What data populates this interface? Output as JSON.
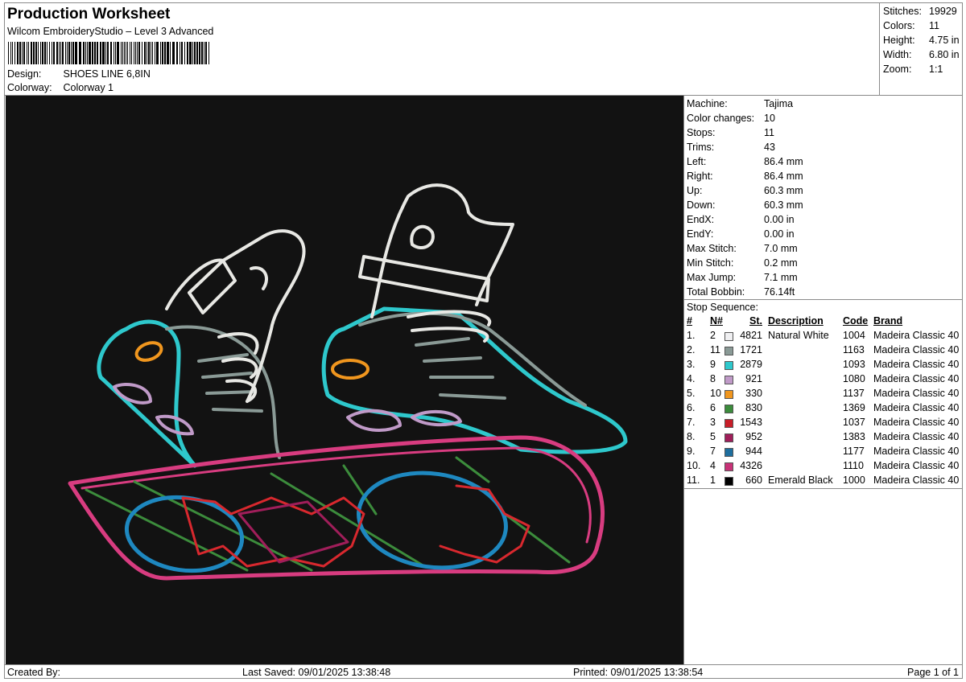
{
  "header": {
    "title": "Production Worksheet",
    "software": "Wilcom EmbroideryStudio – Level 3 Advanced",
    "design_label": "Design:",
    "design_value": "SHOES LINE 6,8IN",
    "colorway_label": "Colorway:",
    "colorway_value": "Colorway 1"
  },
  "summary": [
    {
      "label": "Stitches:",
      "value": "19929"
    },
    {
      "label": "Colors:",
      "value": "11"
    },
    {
      "label": "Height:",
      "value": "4.75 in"
    },
    {
      "label": "Width:",
      "value": "6.80 in"
    },
    {
      "label": "Zoom:",
      "value": "1:1"
    }
  ],
  "machine": [
    {
      "label": "Machine:",
      "value": "Tajima"
    },
    {
      "label": "Color changes:",
      "value": "10"
    },
    {
      "label": "Stops:",
      "value": "11"
    },
    {
      "label": "Trims:",
      "value": "43"
    },
    {
      "label": "Left:",
      "value": "86.4 mm"
    },
    {
      "label": "Right:",
      "value": "86.4 mm"
    },
    {
      "label": "Up:",
      "value": "60.3 mm"
    },
    {
      "label": "Down:",
      "value": "60.3 mm"
    },
    {
      "label": "EndX:",
      "value": "0.00 in"
    },
    {
      "label": "EndY:",
      "value": "0.00 in"
    },
    {
      "label": "Max Stitch:",
      "value": "7.0 mm"
    },
    {
      "label": "Min Stitch:",
      "value": "0.2 mm"
    },
    {
      "label": "Max Jump:",
      "value": "7.1 mm"
    },
    {
      "label": "Total Bobbin:",
      "value": "76.14ft"
    }
  ],
  "stop_sequence": {
    "label": "Stop Sequence:",
    "headers": {
      "num": "#",
      "n": "N#",
      "st": "St.",
      "desc": "Description",
      "code": "Code",
      "brand": "Brand"
    },
    "rows": [
      {
        "num": "1.",
        "n": "2",
        "color": "#f0f0f2",
        "st": "4821",
        "desc": "Natural White",
        "code": "1004",
        "brand": "Madeira Classic 40"
      },
      {
        "num": "2.",
        "n": "11",
        "color": "#8a9a96",
        "st": "1721",
        "desc": "",
        "code": "1163",
        "brand": "Madeira Classic 40"
      },
      {
        "num": "3.",
        "n": "9",
        "color": "#2ec8cc",
        "st": "2879",
        "desc": "",
        "code": "1093",
        "brand": "Madeira Classic 40"
      },
      {
        "num": "4.",
        "n": "8",
        "color": "#c09ac8",
        "st": "921",
        "desc": "",
        "code": "1080",
        "brand": "Madeira Classic 40"
      },
      {
        "num": "5.",
        "n": "10",
        "color": "#f0961e",
        "st": "330",
        "desc": "",
        "code": "1137",
        "brand": "Madeira Classic 40"
      },
      {
        "num": "6.",
        "n": "6",
        "color": "#3c8c3c",
        "st": "830",
        "desc": "",
        "code": "1369",
        "brand": "Madeira Classic 40"
      },
      {
        "num": "7.",
        "n": "3",
        "color": "#c81e28",
        "st": "1543",
        "desc": "",
        "code": "1037",
        "brand": "Madeira Classic 40"
      },
      {
        "num": "8.",
        "n": "5",
        "color": "#a01e5a",
        "st": "952",
        "desc": "",
        "code": "1383",
        "brand": "Madeira Classic 40"
      },
      {
        "num": "9.",
        "n": "7",
        "color": "#1e6e9e",
        "st": "944",
        "desc": "",
        "code": "1177",
        "brand": "Madeira Classic 40"
      },
      {
        "num": "10.",
        "n": "4",
        "color": "#c83278",
        "st": "4326",
        "desc": "",
        "code": "1110",
        "brand": "Madeira Classic 40"
      },
      {
        "num": "11.",
        "n": "1",
        "color": "#000000",
        "st": "660",
        "desc": "Emerald Black",
        "code": "1000",
        "brand": "Madeira Classic 40"
      }
    ]
  },
  "footer": {
    "created_by": "Created By:",
    "last_saved": "Last Saved: 09/01/2025 13:38:48",
    "printed": "Printed: 09/01/2025 13:38:54",
    "page": "Page 1 of 1"
  },
  "design_preview": {
    "background": "#121212",
    "thread_white": "#e8e8e4",
    "thread_grey": "#8a9a96",
    "thread_cyan": "#2ec8cc",
    "thread_lilac": "#c09ac8",
    "thread_orange": "#f0961e",
    "thread_green": "#3c8c3c",
    "thread_red": "#d8282e",
    "thread_blue": "#1e88c0",
    "thread_pink": "#d83c80"
  }
}
